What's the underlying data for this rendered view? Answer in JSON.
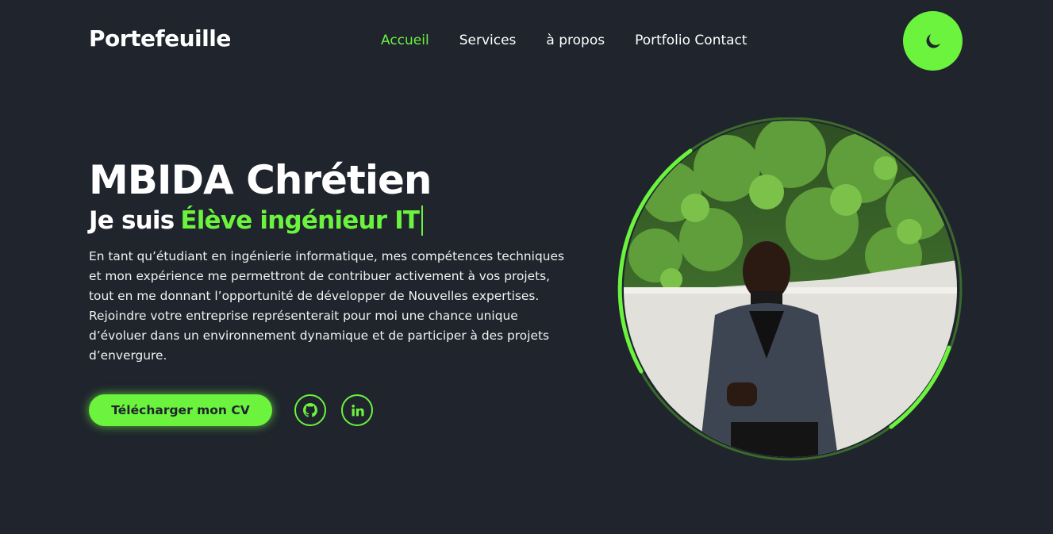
{
  "header": {
    "logo": "Portefeuille",
    "nav": [
      {
        "label": "Accueil",
        "active": true
      },
      {
        "label": "Services",
        "active": false
      },
      {
        "label": "à propos",
        "active": false
      },
      {
        "label": "Portfolio Contact",
        "active": false
      }
    ],
    "theme_toggle_icon": "moon-icon"
  },
  "hero": {
    "name": "MBIDA Chrétien",
    "role_prefix": "Je suis",
    "role_highlight": "Élève ingénieur IT",
    "description": "En tant qu’étudiant en ingénierie informatique, mes compétences techniques et mon expérience me permettront de contribuer activement à vos projets, tout en me donnant l’opportunité de développer de Nouvelles expertises. Rejoindre votre entreprise représenterait pour moi une chance unique d’évoluer dans un environnement dynamique et de participer à des projets d’envergure.",
    "cv_button": "Télécharger mon CV",
    "socials": [
      {
        "icon": "github-icon"
      },
      {
        "icon": "linkedin-icon"
      }
    ]
  },
  "colors": {
    "background": "#1f242d",
    "accent": "#6bf33e",
    "text": "#ffffff"
  }
}
